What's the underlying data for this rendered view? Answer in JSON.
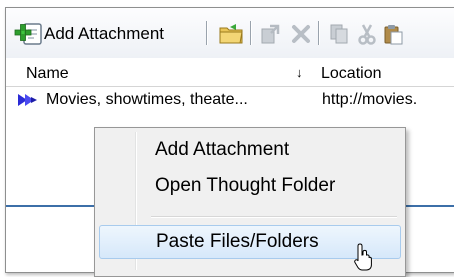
{
  "toolbar": {
    "add_attachment_label": "Add Attachment",
    "icons": [
      "add-attachment-icon",
      "open-folder-icon",
      "move-icon",
      "delete-icon",
      "copy-icon",
      "cut-icon",
      "paste-icon"
    ]
  },
  "list": {
    "columns": {
      "name": "Name",
      "location": "Location",
      "sort_indicator": "↓"
    },
    "rows": [
      {
        "icon": "web-link-icon",
        "name": "Movies, showtimes, theate...",
        "location": "http://movies."
      }
    ]
  },
  "context_menu": {
    "items": [
      {
        "label": "Add Attachment",
        "highlighted": false
      },
      {
        "label": "Open Thought Folder",
        "highlighted": false
      },
      {
        "label": "Paste Files/Folders",
        "highlighted": true
      }
    ]
  },
  "colors": {
    "accent": "#3c6fa8",
    "menu_highlight_border": "#a8cbed",
    "menu_background": "#f0f0f0"
  }
}
